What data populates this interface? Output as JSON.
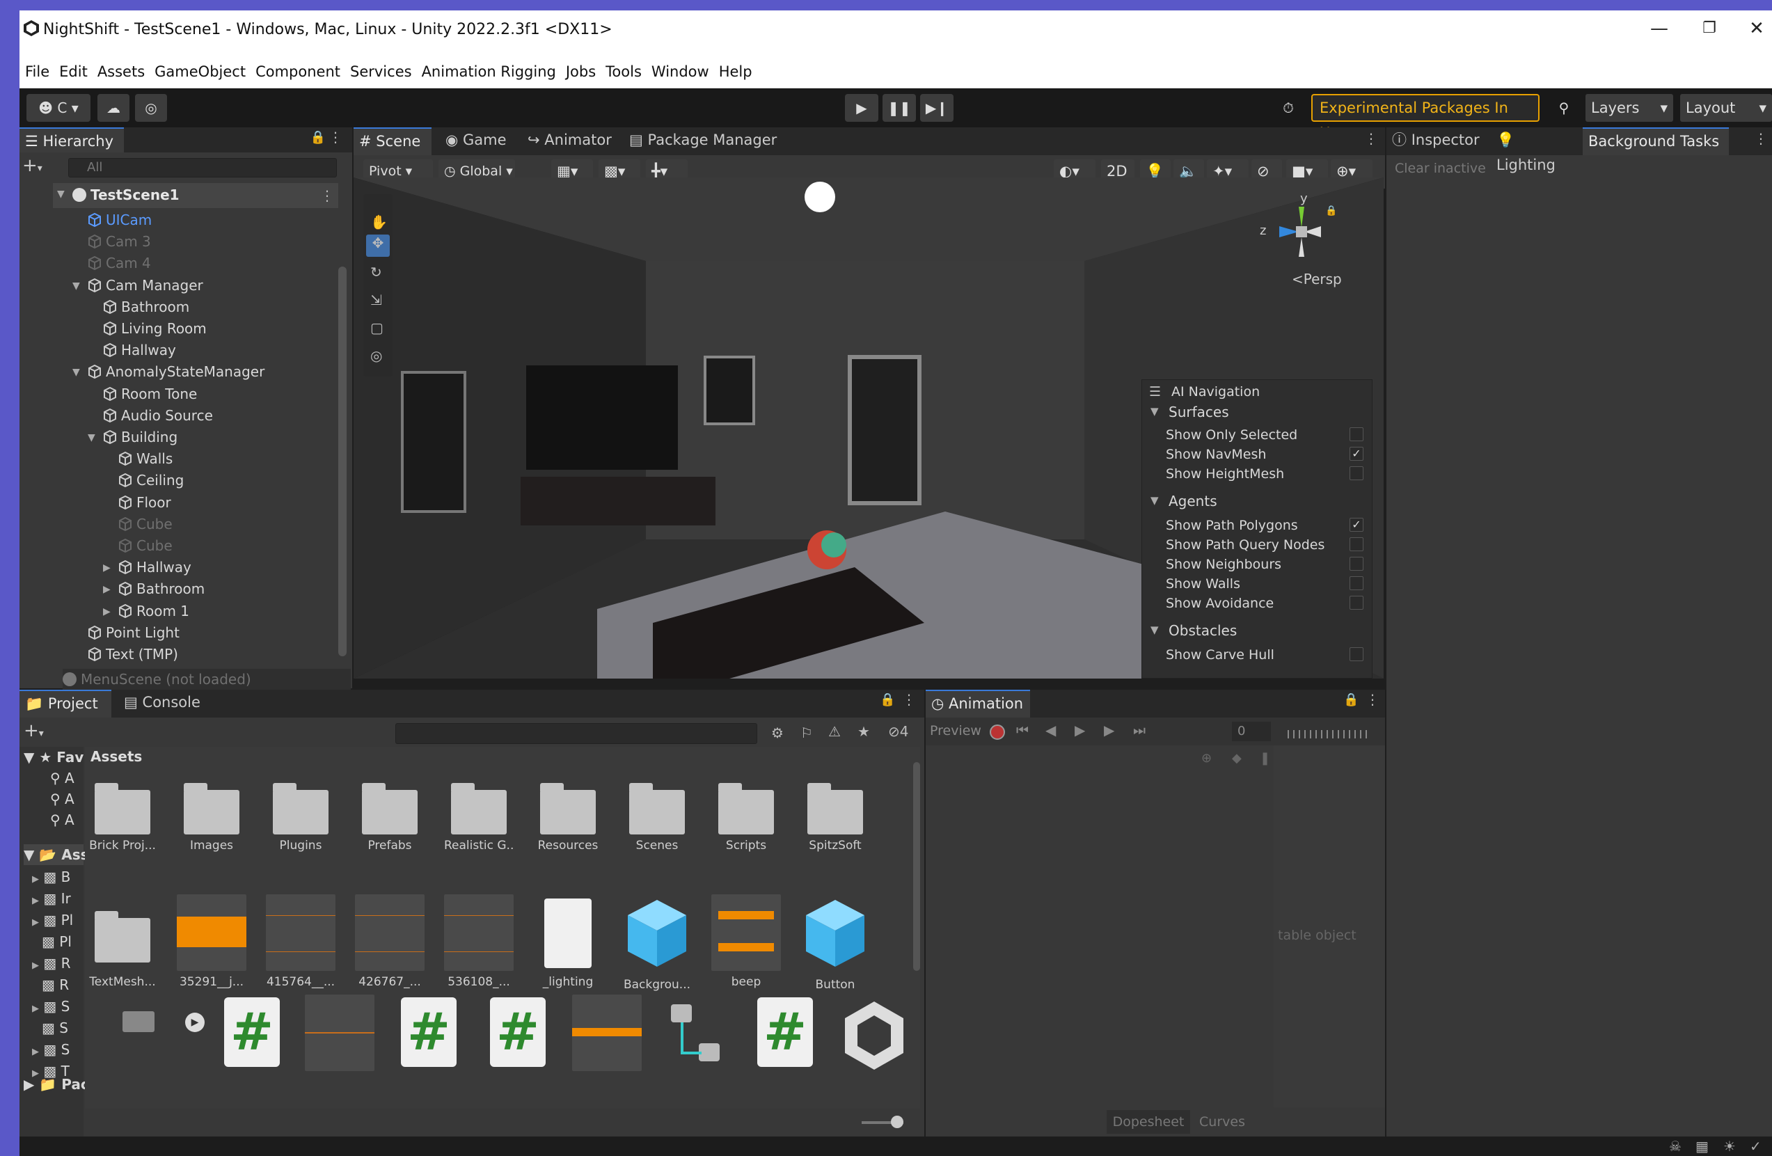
{
  "window": {
    "title": "NightShift - TestScene1 - Windows, Mac, Linux - Unity 2022.2.3f1 <DX11>"
  },
  "menu": [
    "File",
    "Edit",
    "Assets",
    "GameObject",
    "Component",
    "Services",
    "Animation Rigging",
    "Jobs",
    "Tools",
    "Window",
    "Help"
  ],
  "toolbar": {
    "account": "C",
    "experimental": "Experimental Packages In Use",
    "layers": "Layers",
    "layout": "Layout"
  },
  "hierarchy": {
    "tab": "Hierarchy",
    "search_placeholder": "All",
    "scene": "TestScene1",
    "items": [
      {
        "label": "UICam",
        "state": "selected"
      },
      {
        "label": "Cam 3",
        "state": "disabled"
      },
      {
        "label": "Cam 4",
        "state": "disabled"
      },
      {
        "label": "Cam Manager",
        "state": "normal"
      },
      {
        "label": "Bathroom",
        "state": "normal"
      },
      {
        "label": "Living Room",
        "state": "normal"
      },
      {
        "label": "Hallway",
        "state": "normal"
      },
      {
        "label": "AnomalyStateManager",
        "state": "normal"
      },
      {
        "label": "Room Tone",
        "state": "normal"
      },
      {
        "label": "Audio Source",
        "state": "normal"
      },
      {
        "label": "Building",
        "state": "normal"
      },
      {
        "label": "Walls",
        "state": "normal"
      },
      {
        "label": "Ceiling",
        "state": "normal"
      },
      {
        "label": "Floor",
        "state": "normal"
      },
      {
        "label": "Cube",
        "state": "disabled"
      },
      {
        "label": "Cube",
        "state": "disabled"
      },
      {
        "label": "Hallway",
        "state": "normal"
      },
      {
        "label": "Bathroom",
        "state": "normal"
      },
      {
        "label": "Room 1",
        "state": "normal"
      },
      {
        "label": "Point Light",
        "state": "normal"
      },
      {
        "label": "Text (TMP)",
        "state": "normal"
      }
    ],
    "menu_scene": "MenuScene (not loaded)"
  },
  "center_tabs": [
    "Scene",
    "Game",
    "Animator",
    "Package Manager"
  ],
  "scene_toolbar": {
    "pivot": "Pivot",
    "global": "Global",
    "mode2d": "2D"
  },
  "gizmo": {
    "y": "y",
    "z": "z",
    "persp": "<Persp"
  },
  "ai_navigation": {
    "title": "AI Navigation",
    "surfaces": "Surfaces",
    "show_only_selected": "Show Only Selected",
    "show_navmesh": "Show NavMesh",
    "show_heightmesh": "Show HeightMesh",
    "agents": "Agents",
    "show_path_polygons": "Show Path Polygons",
    "show_path_query_nodes": "Show Path Query Nodes",
    "show_neighbours": "Show Neighbours",
    "show_walls": "Show Walls",
    "show_avoidance": "Show Avoidance",
    "obstacles": "Obstacles",
    "show_carve_hull": "Show Carve Hull"
  },
  "right_tabs": [
    "Inspector",
    "Lighting",
    "Background Tasks"
  ],
  "clear_inactive": "Clear inactive",
  "project": {
    "tabs": [
      "Project",
      "Console"
    ],
    "hidden_count": "4",
    "fav_label": "Fav",
    "fav_items": [
      "A",
      "A",
      "A"
    ],
    "assets_root": "Ass",
    "tree": [
      "B",
      "Ir",
      "Pl",
      "Pl",
      "R",
      "R",
      "S",
      "S",
      "S",
      "T"
    ],
    "packages": "Pac",
    "breadcrumb": "Assets",
    "row1": [
      "Brick Proj...",
      "Images",
      "Plugins",
      "Prefabs",
      "Realistic G...",
      "Resources",
      "Scenes",
      "Scripts",
      "SpitzSoft"
    ],
    "row2": [
      "TextMesh...",
      "35291__j...",
      "415764__...",
      "426767_...",
      "536108_...",
      "_lighting",
      "Backgrou...",
      "beep",
      "Button"
    ]
  },
  "animation": {
    "tab": "Animation",
    "preview": "Preview",
    "frame": "0",
    "hint": "table object",
    "dopesheet": "Dopesheet",
    "curves": "Curves"
  }
}
